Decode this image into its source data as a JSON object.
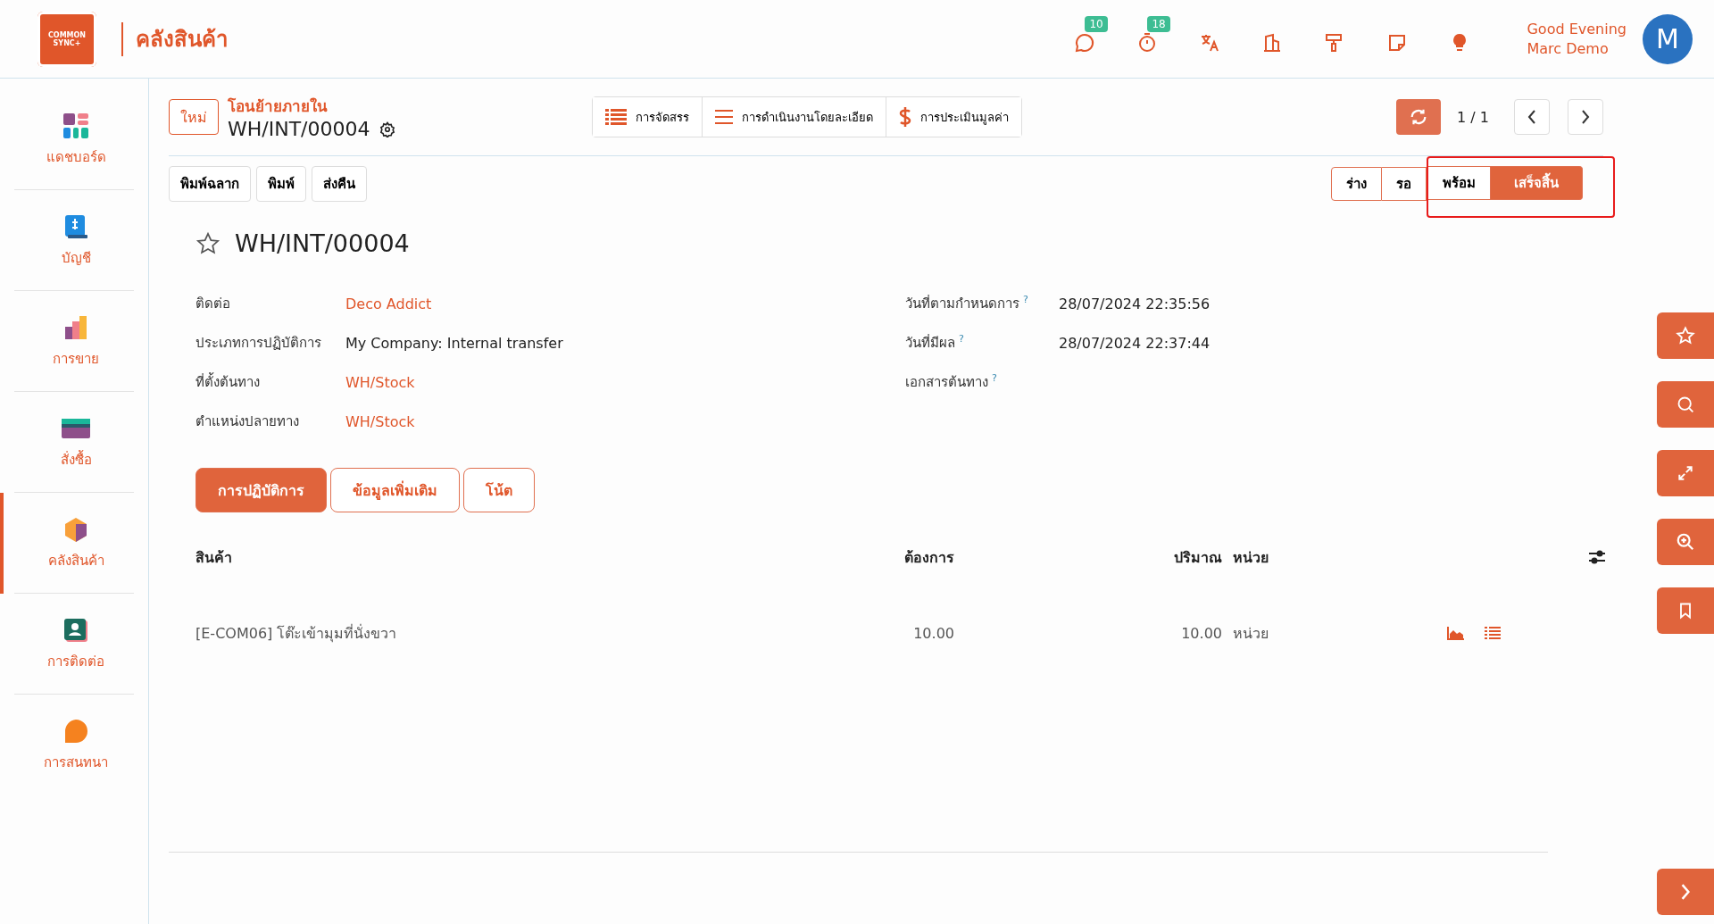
{
  "header": {
    "logo_text": [
      "COMMON",
      "SYNC+"
    ],
    "app_title": "คลังสินค้า",
    "badges": [
      {
        "count": "10"
      },
      {
        "count": "18"
      }
    ],
    "greeting": "Good Evening",
    "user": "Marc Demo",
    "avatar": "M"
  },
  "sidebar": {
    "items": [
      {
        "label": "แดชบอร์ด",
        "selected": false
      },
      {
        "label": "บัญชี",
        "selected": false
      },
      {
        "label": "การขาย",
        "selected": false
      },
      {
        "label": "สั่งซื้อ",
        "selected": false
      },
      {
        "label": "คลังสินค้า",
        "selected": true
      },
      {
        "label": "การติดต่อ",
        "selected": false
      },
      {
        "label": "การสนทนา",
        "selected": false
      }
    ]
  },
  "control": {
    "new_button": "ใหม่",
    "breadcrumb": "โอนย้ายภายใน",
    "record": "WH/INT/00004",
    "smart_buttons": [
      "การจัดสรร",
      "การดำเนินงานโดยละเอียด",
      "การประเมินมูลค่า"
    ],
    "pager": "1 / 1"
  },
  "actions": [
    "พิมพ์ฉลาก",
    "พิมพ์",
    "ส่งคืน"
  ],
  "status_steps": [
    {
      "label": "ร่าง",
      "selected": false,
      "highlighted": false
    },
    {
      "label": "รอ",
      "selected": false,
      "highlighted": false
    },
    {
      "label": "พร้อม",
      "selected": false,
      "highlighted": true
    },
    {
      "label": "เสร็จสิ้น",
      "selected": true,
      "highlighted": true
    }
  ],
  "form": {
    "title": "WH/INT/00004",
    "starred": false,
    "left_fields": [
      {
        "label": "ติดต่อ",
        "value": "Deco Addict",
        "link": true
      },
      {
        "label": "ประเภทการปฏิบัติการ",
        "value": "My Company: Internal transfer",
        "link": false
      },
      {
        "label": "ที่ตั้งต้นทาง",
        "value": "WH/Stock",
        "link": true
      },
      {
        "label": "ตำแหน่งปลายทาง",
        "value": "WH/Stock",
        "link": true
      }
    ],
    "right_fields": [
      {
        "label": "วันที่ตามกำหนดการ",
        "help": "?",
        "value": "28/07/2024 22:35:56"
      },
      {
        "label": "วันที่มีผล",
        "help": "?",
        "value": "28/07/2024 22:37:44"
      },
      {
        "label": "เอกสารต้นทาง",
        "help": "?"
      }
    ],
    "tabs": [
      {
        "label": "การปฏิบัติการ",
        "selected": true
      },
      {
        "label": "ข้อมูลเพิ่มเติม",
        "selected": false
      },
      {
        "label": "โน้ต",
        "selected": false
      }
    ]
  },
  "table": {
    "columns": [
      "สินค้า",
      "ต้องการ",
      "ปริมาณ",
      "หน่วย"
    ],
    "rows": [
      {
        "product": "[E-COM06] โต๊ะเข้ามุมที่นั่งขวา",
        "demand": "10.00",
        "quantity": "10.00",
        "unit": "หน่วย"
      }
    ]
  }
}
